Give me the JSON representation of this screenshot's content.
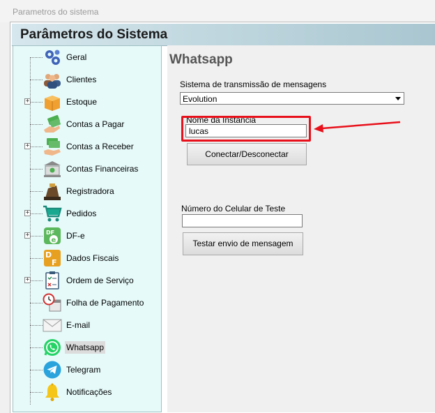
{
  "window": {
    "title": "Parametros do sistema"
  },
  "header": {
    "title": "Parâmetros do Sistema"
  },
  "sidebar": {
    "items": [
      {
        "label": "Geral",
        "icon": "gears-icon",
        "expandable": false
      },
      {
        "label": "Clientes",
        "icon": "people-icon",
        "expandable": false
      },
      {
        "label": "Estoque",
        "icon": "box-icon",
        "expandable": true
      },
      {
        "label": "Contas a Pagar",
        "icon": "money-hand-icon",
        "expandable": false
      },
      {
        "label": "Contas a Receber",
        "icon": "money-receive-icon",
        "expandable": true
      },
      {
        "label": "Contas Financeiras",
        "icon": "bank-icon",
        "expandable": false
      },
      {
        "label": "Registradora",
        "icon": "cash-register-icon",
        "expandable": false
      },
      {
        "label": "Pedidos",
        "icon": "cart-icon",
        "expandable": true
      },
      {
        "label": "DF-e",
        "icon": "dfe-icon",
        "expandable": true
      },
      {
        "label": "Dados Fiscais",
        "icon": "df-icon",
        "expandable": false
      },
      {
        "label": "Ordem de Serviço",
        "icon": "checklist-icon",
        "expandable": true
      },
      {
        "label": "Folha de Pagamento",
        "icon": "clock-calendar-icon",
        "expandable": false
      },
      {
        "label": "E-mail",
        "icon": "envelope-icon",
        "expandable": false
      },
      {
        "label": "Whatsapp",
        "icon": "whatsapp-icon",
        "expandable": false,
        "selected": true
      },
      {
        "label": "Telegram",
        "icon": "telegram-icon",
        "expandable": false
      },
      {
        "label": "Notificações",
        "icon": "bell-icon",
        "expandable": false
      }
    ]
  },
  "main": {
    "title": "Whatsapp",
    "system_label": "Sistema de transmissão de mensagens",
    "system_value": "Evolution",
    "instance_label": "Nome da Instância",
    "instance_value": "lucas",
    "connect_button": "Conectar/Desconectar",
    "phone_label": "Número do Celular de Teste",
    "phone_value": "",
    "test_button": "Testar envio de mensagem"
  },
  "annotation": {
    "highlight_color": "#e8101a"
  }
}
